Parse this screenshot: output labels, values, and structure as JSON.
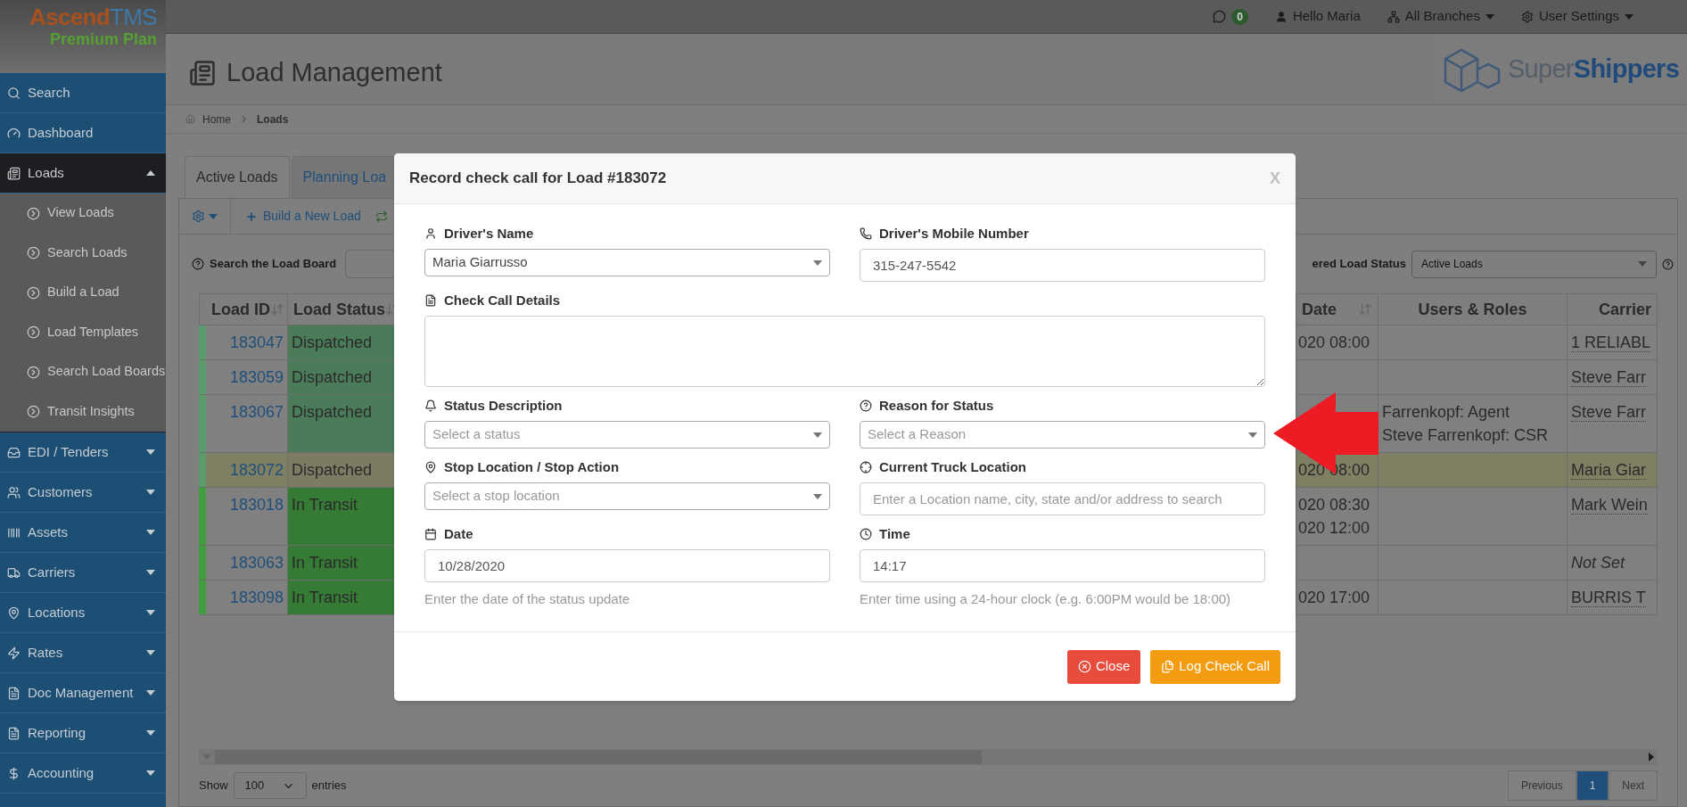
{
  "app": {
    "logo_primary": "Ascend",
    "logo_secondary": "TMS",
    "plan": "Premium Plan"
  },
  "top_bar": {
    "messages_count": "0",
    "greeting": "Hello Maria",
    "branches": "All Branches",
    "settings": "User Settings"
  },
  "sidebar": {
    "items": [
      {
        "label": "Search",
        "kind": "link",
        "selected": false
      },
      {
        "label": "Dashboard",
        "kind": "link",
        "selected": false
      },
      {
        "label": "Loads",
        "kind": "menu",
        "selected": true,
        "expanded": true,
        "children": [
          {
            "label": "View Loads"
          },
          {
            "label": "Search Loads"
          },
          {
            "label": "Build a Load"
          },
          {
            "label": "Load Templates"
          },
          {
            "label": "Search Load Boards"
          },
          {
            "label": "Transit Insights"
          }
        ]
      },
      {
        "label": "EDI / Tenders",
        "kind": "menu",
        "selected": false,
        "expanded": false
      },
      {
        "label": "Customers",
        "kind": "menu",
        "selected": false,
        "expanded": false
      },
      {
        "label": "Assets",
        "kind": "menu",
        "selected": false,
        "expanded": false
      },
      {
        "label": "Carriers",
        "kind": "menu",
        "selected": false,
        "expanded": false
      },
      {
        "label": "Locations",
        "kind": "menu",
        "selected": false,
        "expanded": false
      },
      {
        "label": "Rates",
        "kind": "menu",
        "selected": false,
        "expanded": false
      },
      {
        "label": "Doc Management",
        "kind": "menu",
        "selected": false,
        "expanded": false
      },
      {
        "label": "Reporting",
        "kind": "menu",
        "selected": false,
        "expanded": false
      },
      {
        "label": "Accounting",
        "kind": "menu",
        "selected": false,
        "expanded": false
      }
    ]
  },
  "page": {
    "title": "Load Management",
    "company_logo": {
      "part1": "Super",
      "part2": "Shippers"
    },
    "breadcrumb": [
      {
        "label": "Home"
      },
      {
        "label": "Loads"
      }
    ]
  },
  "tabs": [
    {
      "label": "Active Loads",
      "selected": true
    },
    {
      "label": "Planning Loa",
      "selected": false
    }
  ],
  "toolbar": {
    "build_button": "Build a New Load"
  },
  "search": {
    "label": "Search the Load Board"
  },
  "status_filter": {
    "label": "ered Load Status",
    "value": "Active Loads"
  },
  "table": {
    "columns": [
      {
        "label": "Load ID",
        "sortable": true
      },
      {
        "label": "Load Status",
        "sortable": true
      },
      {
        "label": "Date",
        "sortable": true
      },
      {
        "label": "Users & Roles",
        "sortable": false
      },
      {
        "label": "Carrier",
        "sortable": false
      }
    ],
    "rows": [
      {
        "load_id": "183047",
        "status": "Dispatched",
        "kind": "dispatched",
        "highlighted": false,
        "date": [
          "020 08:00"
        ],
        "users": [],
        "carrier": "1 RELIABL",
        "carrier_assigned": true
      },
      {
        "load_id": "183059",
        "status": "Dispatched",
        "kind": "dispatched",
        "highlighted": false,
        "date": [],
        "users": [],
        "carrier": "Steve Farr",
        "carrier_assigned": true
      },
      {
        "load_id": "183067",
        "status": "Dispatched",
        "kind": "dispatched",
        "highlighted": false,
        "date": [],
        "users": [
          "Farrenkopf: Agent",
          "Steve Farrenkopf: CSR"
        ],
        "carrier": "Steve Farr",
        "carrier_assigned": true
      },
      {
        "load_id": "183072",
        "status": "Dispatched",
        "kind": "dispatched",
        "highlighted": true,
        "date": [
          "020 08:00"
        ],
        "users": [],
        "carrier": "Maria Giar",
        "carrier_assigned": true
      },
      {
        "load_id": "183018",
        "status": "In Transit",
        "kind": "transit",
        "highlighted": false,
        "date": [
          "020 08:30",
          "020 12:00"
        ],
        "users": [],
        "carrier": "Mark Wein",
        "carrier_assigned": true
      },
      {
        "load_id": "183063",
        "status": "In Transit",
        "kind": "transit",
        "highlighted": false,
        "date": [],
        "users": [],
        "carrier": "Not Set",
        "carrier_assigned": false
      },
      {
        "load_id": "183098",
        "status": "In Transit",
        "kind": "transit",
        "highlighted": false,
        "date": [
          "020 17:00"
        ],
        "users": [],
        "carrier": "BURRIS T",
        "carrier_assigned": true
      }
    ]
  },
  "footer": {
    "show_label": "Show",
    "page_size": "100",
    "entries_label": "entries",
    "pagination": [
      {
        "label": "Previous",
        "selected": false
      },
      {
        "label": "1",
        "selected": true
      },
      {
        "label": "Next",
        "selected": false
      }
    ]
  },
  "modal": {
    "title": "Record check call for Load #183072",
    "close": "X",
    "fields": [
      {
        "label": "Driver's Name",
        "kind": "select",
        "value": "Maria Giarrusso"
      },
      {
        "label": "Driver's Mobile Number",
        "kind": "input",
        "value": "315-247-5542"
      },
      {
        "label": "Check Call Details",
        "kind": "textarea"
      },
      {
        "label": "Status Description",
        "kind": "select",
        "placeholder": "Select a status"
      },
      {
        "label": "Reason for Status",
        "kind": "select",
        "placeholder": "Select a Reason"
      },
      {
        "label": "Stop Location / Stop Action",
        "kind": "select",
        "placeholder": "Select a stop location"
      },
      {
        "label": "Current Truck Location",
        "kind": "input",
        "placeholder": "Enter a Location name, city, state and/or address to search"
      },
      {
        "label": "Date",
        "kind": "input",
        "value": "10/28/2020",
        "help": "Enter the date of the status update"
      },
      {
        "label": "Time",
        "kind": "input",
        "value": "14:17",
        "help": "Enter time using a 24-hour clock (e.g. 6:00PM would be 18:00)"
      }
    ],
    "buttons": [
      {
        "label": "Close",
        "kind": "danger"
      },
      {
        "label": "Log Check Call",
        "kind": "warning"
      }
    ]
  }
}
